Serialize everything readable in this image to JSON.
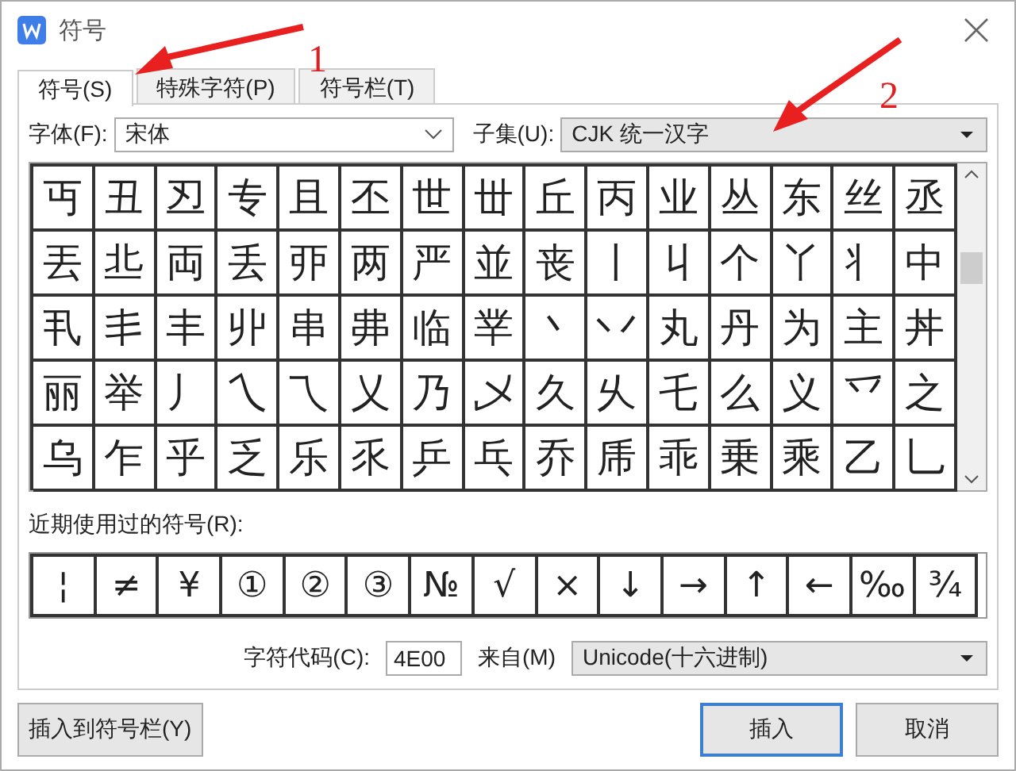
{
  "window": {
    "title": "符号"
  },
  "tabs": [
    {
      "label": "符号(S)",
      "selected": true
    },
    {
      "label": "特殊字符(P)",
      "selected": false
    },
    {
      "label": "符号栏(T)",
      "selected": false
    }
  ],
  "font": {
    "label": "字体(F):",
    "value": "宋体"
  },
  "subset": {
    "label": "子集(U):",
    "value": "CJK 统一汉字"
  },
  "grid": {
    "rows": [
      [
        "丏",
        "丑",
        "丒",
        "专",
        "且",
        "丕",
        "世",
        "丗",
        "丘",
        "丙",
        "业",
        "丛",
        "东",
        "丝",
        "丞"
      ],
      [
        "丟",
        "丠",
        "両",
        "丢",
        "丣",
        "两",
        "严",
        "並",
        "丧",
        "丨",
        "丩",
        "个",
        "丫",
        "丬",
        "中"
      ],
      [
        "丮",
        "丯",
        "丰",
        "丱",
        "串",
        "丳",
        "临",
        "丵",
        "丶",
        "丷",
        "丸",
        "丹",
        "为",
        "主",
        "丼"
      ],
      [
        "丽",
        "举",
        "丿",
        "乀",
        "乁",
        "乂",
        "乃",
        "乄",
        "久",
        "乆",
        "乇",
        "么",
        "义",
        "乊",
        "之"
      ],
      [
        "乌",
        "乍",
        "乎",
        "乏",
        "乐",
        "乑",
        "乒",
        "乓",
        "乔",
        "乕",
        "乖",
        "乗",
        "乘",
        "乙",
        "乚"
      ]
    ]
  },
  "recent": {
    "label": "近期使用过的符号(R):",
    "symbols": [
      "¦",
      "≠",
      "¥",
      "①",
      "②",
      "③",
      "№",
      "√",
      "×",
      "↓",
      "→",
      "↑",
      "←",
      "‰",
      "¾"
    ]
  },
  "char_code": {
    "label": "字符代码(C):",
    "value": "4E00"
  },
  "source": {
    "label": "来自(M)",
    "value": "Unicode(十六进制)"
  },
  "buttons": [
    {
      "label": "插入到符号栏(Y)",
      "kind": "side"
    },
    {
      "label": "插入",
      "kind": "default"
    },
    {
      "label": "取消",
      "kind": "normal"
    }
  ],
  "annotations": [
    {
      "text": "1"
    },
    {
      "text": "2"
    }
  ]
}
